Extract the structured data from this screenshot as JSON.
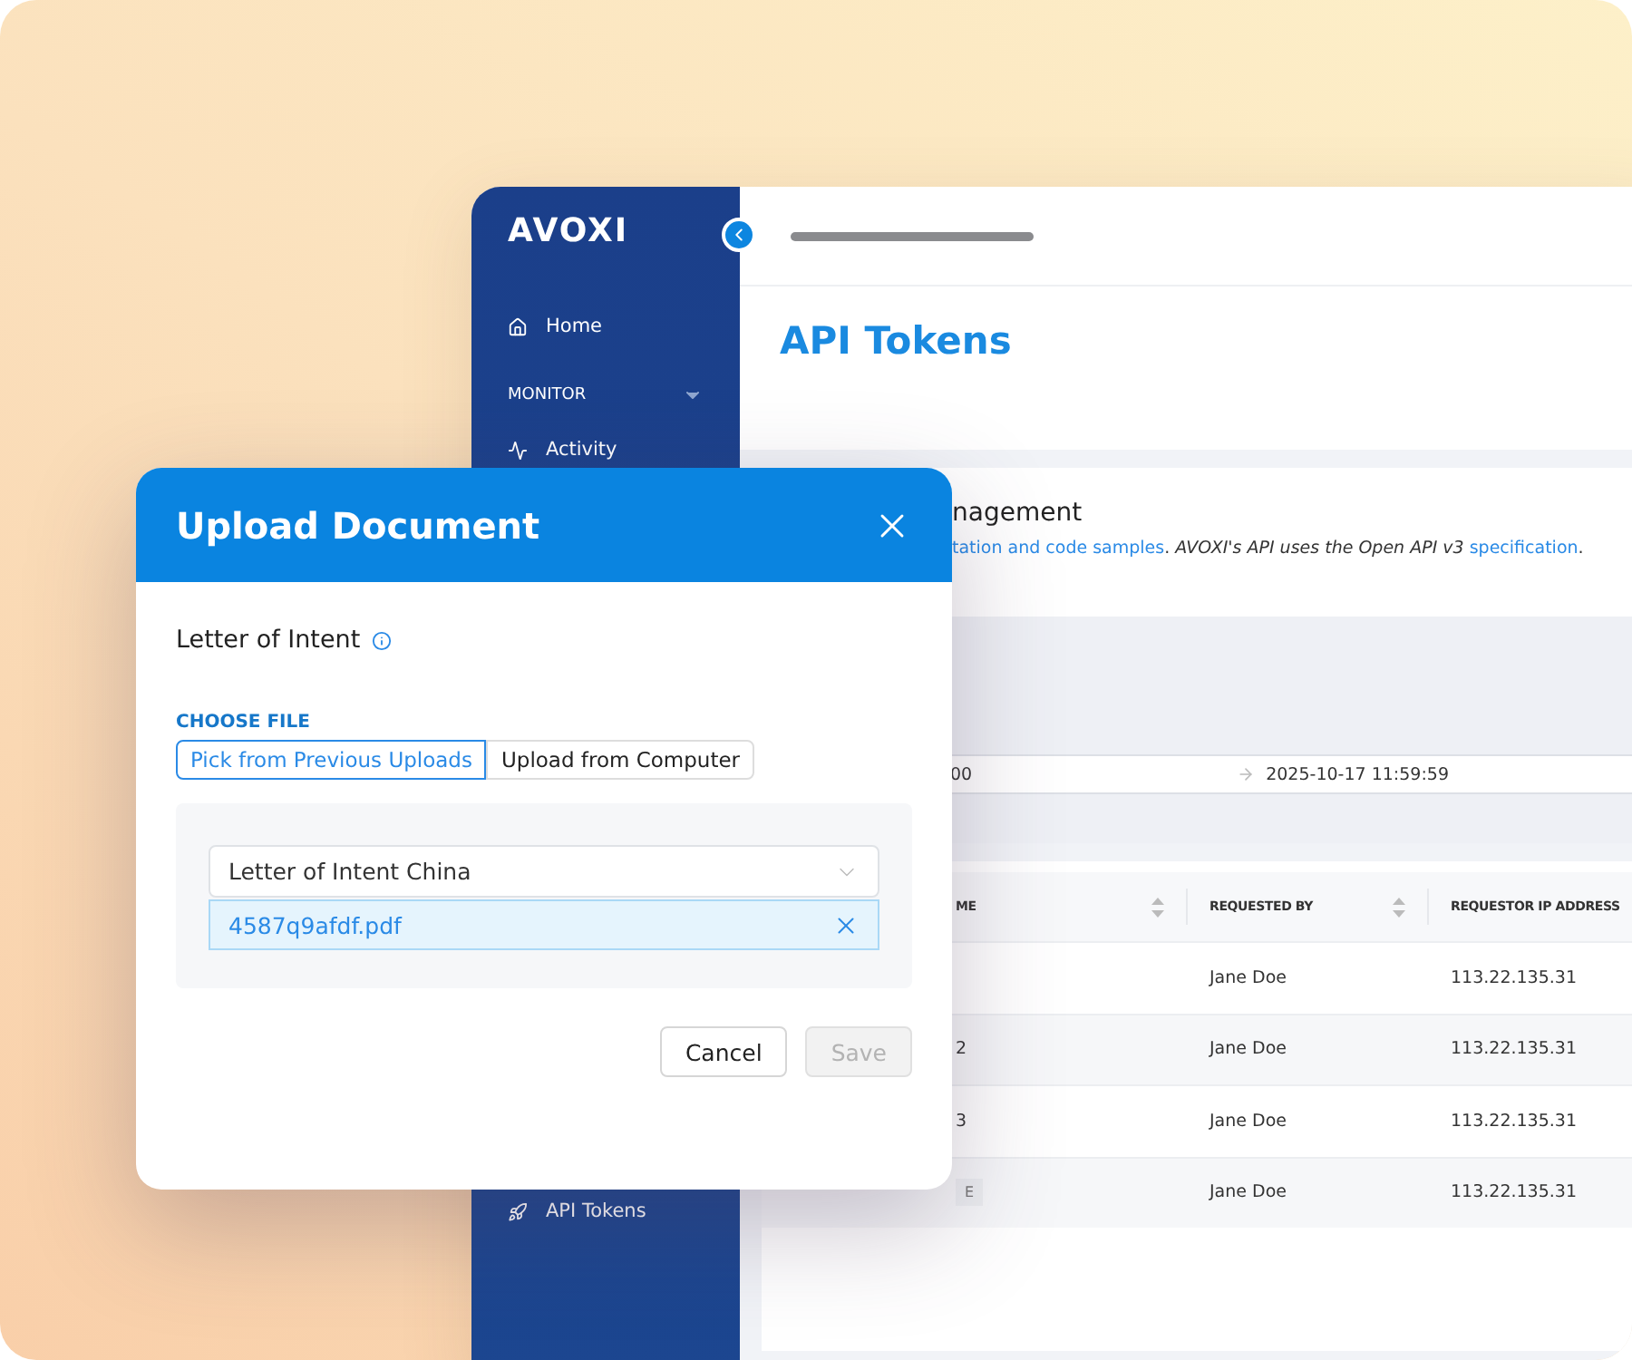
{
  "sidebar": {
    "logo": "AVOXI",
    "items": [
      {
        "kind": "home",
        "label": "Home"
      },
      {
        "kind": "section",
        "label": "MONITOR",
        "expanded": true
      },
      {
        "kind": "activity",
        "label": "Activity"
      },
      {
        "kind": "tokens",
        "label": "API Tokens"
      }
    ]
  },
  "page_title": "API Tokens",
  "card": {
    "title": "nagement",
    "description": [
      {
        "kind": "link",
        "text": "tation and code samples"
      },
      {
        "kind": "text",
        "text": ". *AVOXI's API uses the Open API v3* "
      },
      {
        "kind": "link",
        "text": "specification"
      },
      {
        "kind": "text",
        "text": "."
      }
    ]
  },
  "date_range": {
    "start": "00",
    "end": "2025-10-17 11:59:59"
  },
  "table": {
    "columns": [
      {
        "label": "ME",
        "sortable": true
      },
      {
        "label": "REQUESTED BY",
        "sortable": true
      },
      {
        "label": "REQUESTOR IP ADDRESS"
      }
    ],
    "rows": [
      {
        "requested_by": "Jane Doe",
        "ip": "113.22.135.31"
      },
      {
        "name": "2",
        "requested_by": "Jane Doe",
        "ip": "113.22.135.31"
      },
      {
        "name": "3",
        "requested_by": "Jane Doe",
        "ip": "113.22.135.31"
      },
      {
        "tag": "E",
        "requested_by": "Jane Doe",
        "ip": "113.22.135.31"
      }
    ]
  },
  "modal": {
    "title": "Upload Document",
    "field_label": "Letter of Intent",
    "section_label": "CHOOSE FILE",
    "tabs": [
      {
        "label": "Pick from Previous Uploads",
        "selected": true
      },
      {
        "label": "Upload from Computer",
        "selected": false
      }
    ],
    "select": {
      "value": "Letter of Intent China"
    },
    "file": {
      "name": "4587q9afdf.pdf"
    },
    "buttons": [
      {
        "label": "Cancel",
        "disabled": false
      },
      {
        "label": "Save",
        "disabled": true
      }
    ]
  }
}
